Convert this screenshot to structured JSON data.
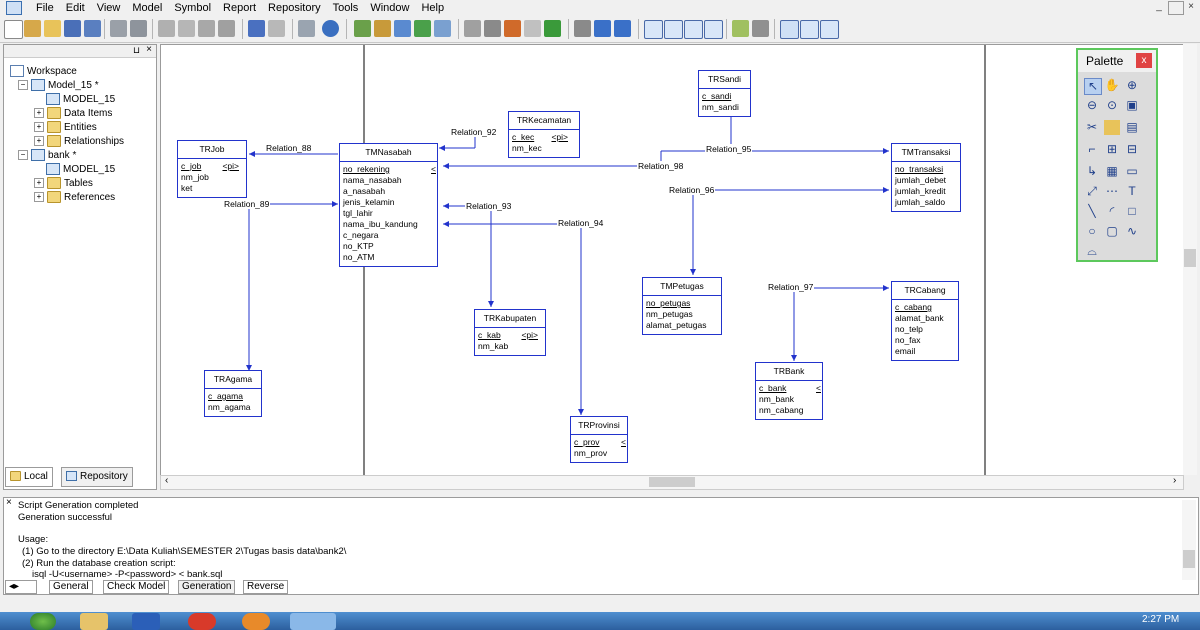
{
  "menu": [
    "File",
    "Edit",
    "View",
    "Model",
    "Symbol",
    "Report",
    "Repository",
    "Tools",
    "Window",
    "Help"
  ],
  "window_controls": [
    "_",
    "×"
  ],
  "browser": {
    "tree": [
      {
        "label": "Workspace",
        "level": 0,
        "icon": "workspace-icon"
      },
      {
        "label": "Model_15 *",
        "level": 1,
        "icon": "model-icon"
      },
      {
        "label": "MODEL_15",
        "level": 2,
        "icon": "diagram-icon"
      },
      {
        "label": "Data Items",
        "level": 2,
        "icon": "folder-icon"
      },
      {
        "label": "Entities",
        "level": 2,
        "icon": "folder-icon"
      },
      {
        "label": "Relationships",
        "level": 2,
        "icon": "folder-icon"
      },
      {
        "label": "bank *",
        "level": 1,
        "icon": "model-icon"
      },
      {
        "label": "MODEL_15",
        "level": 2,
        "icon": "diagram-icon"
      },
      {
        "label": "Tables",
        "level": 2,
        "icon": "folder-icon"
      },
      {
        "label": "References",
        "level": 2,
        "icon": "folder-icon"
      }
    ],
    "tabs": [
      "Local",
      "Repository"
    ]
  },
  "entities": {
    "trjob": {
      "name": "TRJob",
      "attrs": [
        "c_job",
        "nm_job",
        "ket"
      ],
      "pk": "<pi>"
    },
    "tmnasabah": {
      "name": "TMNasabah",
      "attrs": [
        "no_rekening",
        "nama_nasabah",
        "a_nasabah",
        "jenis_kelamin",
        "tgl_lahir",
        "nama_ibu_kandung",
        "c_negara",
        "no_KTP",
        "no_ATM"
      ],
      "pk": "<"
    },
    "trkecamatan": {
      "name": "TRKecamatan",
      "attrs": [
        "c_kec",
        "nm_kec"
      ],
      "pk": "<pi>"
    },
    "trsandi": {
      "name": "TRSandi",
      "attrs": [
        "c_sandi",
        "nm_sandi"
      ]
    },
    "tmtransaksi": {
      "name": "TMTransaksi",
      "attrs": [
        "no_transaksi",
        "jumlah_debet",
        "jumlah_kredit",
        "jumlah_saldo"
      ]
    },
    "tragama": {
      "name": "TRAgama",
      "attrs": [
        "c_agama",
        "nm_agama"
      ]
    },
    "trkabupaten": {
      "name": "TRKabupaten",
      "attrs": [
        "c_kab",
        "nm_kab"
      ],
      "pk": "<pi>"
    },
    "tmpetugas": {
      "name": "TMPetugas",
      "attrs": [
        "no_petugas",
        "nm_petugas",
        "alamat_petugas"
      ]
    },
    "trcabang": {
      "name": "TRCabang",
      "attrs": [
        "c_cabang",
        "alamat_bank",
        "no_telp",
        "no_fax",
        "email"
      ]
    },
    "trbank": {
      "name": "TRBank",
      "attrs": [
        "c_bank",
        "nm_bank",
        "nm_cabang"
      ],
      "pk": "<"
    },
    "trprovinsi": {
      "name": "TRProvinsi",
      "attrs": [
        "c_prov",
        "nm_prov"
      ],
      "pk": "<"
    }
  },
  "relations": {
    "r88": "Relation_88",
    "r89": "Relation_89",
    "r92": "Relation_92",
    "r93": "Relation_93",
    "r94": "Relation_94",
    "r95": "Relation_95",
    "r96": "Relation_96",
    "r97": "Relation_97",
    "r98": "Relation_98"
  },
  "palette": {
    "title": "Palette",
    "close": "x"
  },
  "output": {
    "lines": [
      "Script Generation completed",
      "Generation successful",
      "",
      "Usage:",
      "  (1) Go to the directory E:\\Data Kuliah\\SEMESTER 2\\Tugas basis data\\bank2\\",
      "  (2) Run the database creation script:",
      "      isql -U<username> -P<password>  < bank.sql"
    ],
    "tabs": [
      "General",
      "Check Model",
      "Generation",
      "Reverse"
    ]
  },
  "taskbar": {
    "clock": "2:27 PM"
  }
}
